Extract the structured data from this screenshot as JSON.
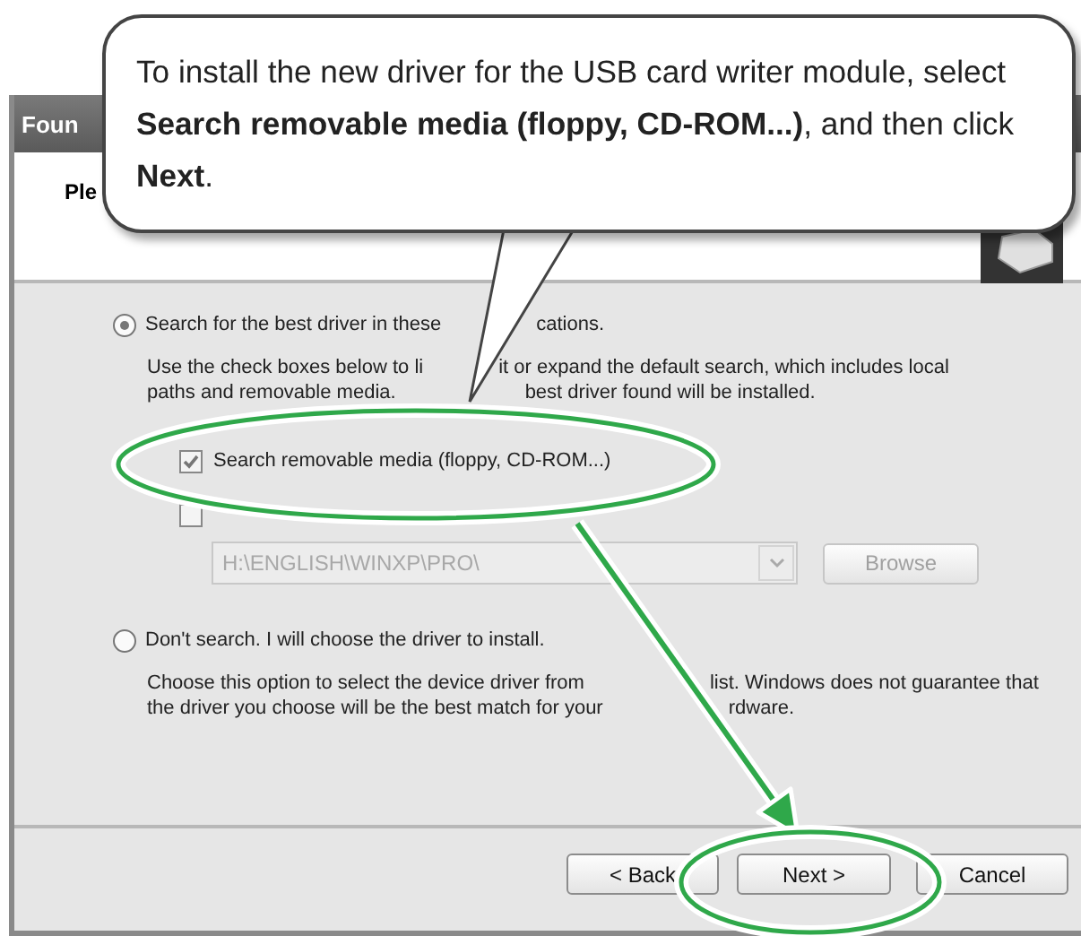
{
  "callout": {
    "text": "To install the new driver for the USB card writer module, select **Search removable media (floppy, CD-ROM...)**, and then click **Next**."
  },
  "window": {
    "title": "Foun",
    "header": "Ple"
  },
  "options": [
    {
      "label_parts": [
        "Search for the best driver in these",
        "cations."
      ],
      "selected": true,
      "description_lines": [
        [
          "Use the check boxes below to li",
          "it or expand the default search, which includes local"
        ],
        [
          "paths and removable media.",
          "best driver found will be installed."
        ]
      ]
    },
    {
      "label_parts": [
        "Don't search. I will choose the driver to install."
      ],
      "selected": false,
      "description_lines": [
        [
          "Choose this option to select the device driver from",
          "list.  Windows does not guarantee that"
        ],
        [
          "the driver you choose will be the best match for your",
          "rdware."
        ]
      ]
    }
  ],
  "checkboxes": [
    {
      "label": "Search removable media (floppy, CD-ROM...)",
      "checked": true
    },
    {
      "checked": false
    }
  ],
  "location": {
    "value": "H:\\ENGLISH\\WINXP\\PRO\\",
    "disabled": true
  },
  "browse": {
    "label": "Browse",
    "disabled": true
  },
  "buttons": [
    {
      "label": "< Back"
    },
    {
      "label": "Next >"
    },
    {
      "label": "Cancel"
    }
  ]
}
